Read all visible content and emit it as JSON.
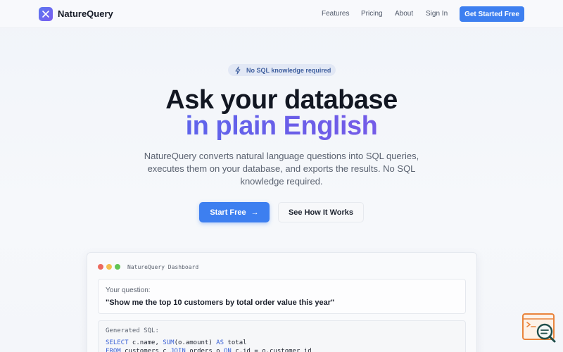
{
  "nav": {
    "brand": "NatureQuery",
    "links": [
      "Features",
      "Pricing",
      "About",
      "Sign In"
    ],
    "cta": "Get Started Free"
  },
  "hero": {
    "badge": "No SQL knowledge required",
    "title_line1": "Ask your database",
    "title_line2": "in plain English",
    "subtitle": "NatureQuery converts natural language questions into SQL queries, executes them on your database, and exports the results. No SQL knowledge required.",
    "primary_button": "Start Free",
    "secondary_button": "See How It Works"
  },
  "dashboard": {
    "title": "NatureQuery Dashboard",
    "question_label": "Your question:",
    "question_text": "\"Show me the top 10 customers by total order value this year\"",
    "sql_label": "Generated SQL:",
    "sql_lines": [
      "SELECT c.name, SUM(o.amount) AS total",
      "FROM customers c JOIN orders o ON c.id = o.customer_id"
    ]
  },
  "colors": {
    "accent": "#3d7ff0",
    "gradient_start": "#4a6ef0",
    "gradient_end": "#8a58e6",
    "window_dot_red": "#ec6a5e",
    "window_dot_yellow": "#f4bf4f",
    "window_dot_green": "#61c554"
  },
  "icons": {
    "logo": "x-logo-icon",
    "badge": "lightning-icon",
    "primary_button": "arrow-right-icon",
    "widget": "search-chat-icon"
  }
}
